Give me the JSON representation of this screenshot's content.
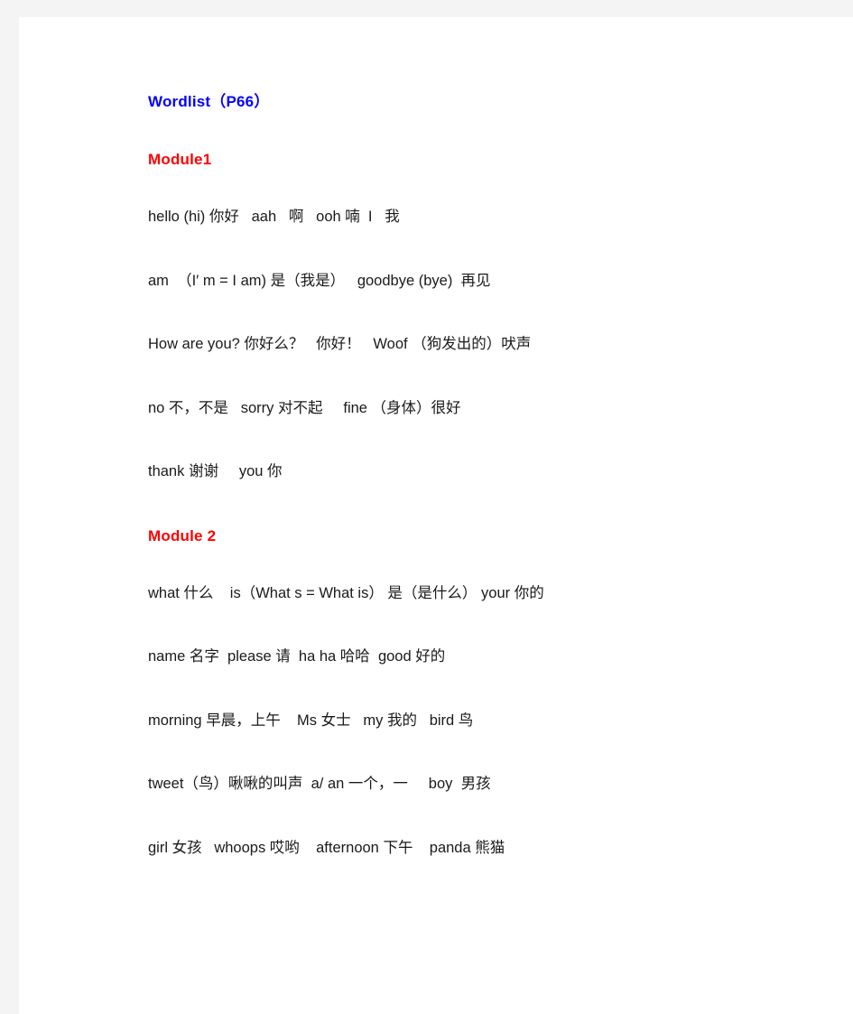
{
  "document": {
    "title": "Wordlist（P66）",
    "title_color": "#0000ff",
    "heading_color": "#ff0000",
    "body_color": "#1a1a1a",
    "page_background": "#ffffff",
    "canvas_background": "#f4f4f4"
  },
  "modules": [
    {
      "heading": "Module1",
      "lines": [
        "hello (hi) 你好   aah   啊   ooh 喃  I   我",
        "am  （I′ m = I am) 是（我是）   goodbye (bye)  再见",
        "How are you? 你好么？   你好！   Woof （狗发出的）吠声",
        "no 不，不是   sorry 对不起     fine （身体）很好",
        "thank 谢谢     you 你"
      ]
    },
    {
      "heading": "Module 2",
      "lines": [
        "what 什么    is（What s = What is） 是（是什么） your 你的",
        "name 名字  please 请  ha ha 哈哈  good 好的",
        "morning 早晨，上午    Ms 女士   my 我的   bird 鸟",
        "tweet（鸟）啾啾的叫声  a/ an 一个，一     boy  男孩",
        "girl 女孩   whoops 哎哟    afternoon 下午    panda 熊猫"
      ]
    }
  ]
}
